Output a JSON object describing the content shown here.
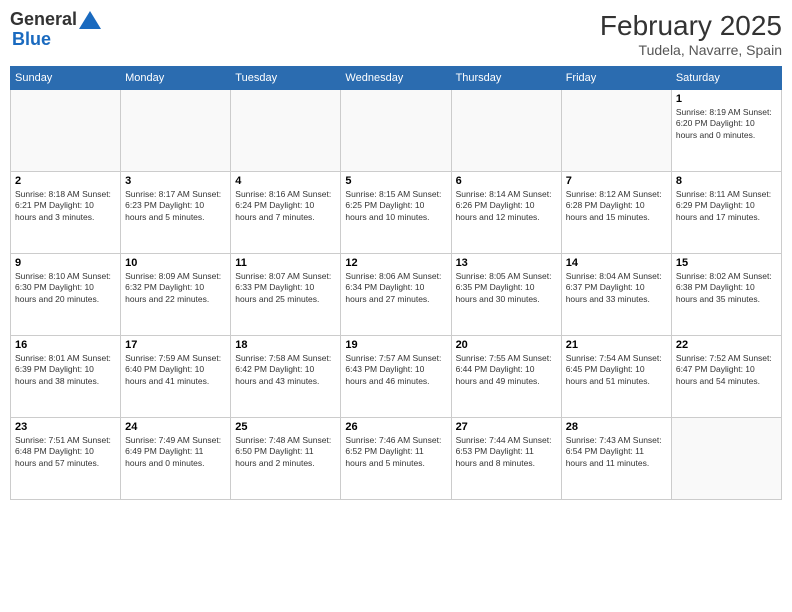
{
  "header": {
    "logo_general": "General",
    "logo_blue": "Blue",
    "month_title": "February 2025",
    "location": "Tudela, Navarre, Spain"
  },
  "days_of_week": [
    "Sunday",
    "Monday",
    "Tuesday",
    "Wednesday",
    "Thursday",
    "Friday",
    "Saturday"
  ],
  "weeks": [
    [
      {
        "day": "",
        "info": ""
      },
      {
        "day": "",
        "info": ""
      },
      {
        "day": "",
        "info": ""
      },
      {
        "day": "",
        "info": ""
      },
      {
        "day": "",
        "info": ""
      },
      {
        "day": "",
        "info": ""
      },
      {
        "day": "1",
        "info": "Sunrise: 8:19 AM\nSunset: 6:20 PM\nDaylight: 10 hours\nand 0 minutes."
      }
    ],
    [
      {
        "day": "2",
        "info": "Sunrise: 8:18 AM\nSunset: 6:21 PM\nDaylight: 10 hours\nand 3 minutes."
      },
      {
        "day": "3",
        "info": "Sunrise: 8:17 AM\nSunset: 6:23 PM\nDaylight: 10 hours\nand 5 minutes."
      },
      {
        "day": "4",
        "info": "Sunrise: 8:16 AM\nSunset: 6:24 PM\nDaylight: 10 hours\nand 7 minutes."
      },
      {
        "day": "5",
        "info": "Sunrise: 8:15 AM\nSunset: 6:25 PM\nDaylight: 10 hours\nand 10 minutes."
      },
      {
        "day": "6",
        "info": "Sunrise: 8:14 AM\nSunset: 6:26 PM\nDaylight: 10 hours\nand 12 minutes."
      },
      {
        "day": "7",
        "info": "Sunrise: 8:12 AM\nSunset: 6:28 PM\nDaylight: 10 hours\nand 15 minutes."
      },
      {
        "day": "8",
        "info": "Sunrise: 8:11 AM\nSunset: 6:29 PM\nDaylight: 10 hours\nand 17 minutes."
      }
    ],
    [
      {
        "day": "9",
        "info": "Sunrise: 8:10 AM\nSunset: 6:30 PM\nDaylight: 10 hours\nand 20 minutes."
      },
      {
        "day": "10",
        "info": "Sunrise: 8:09 AM\nSunset: 6:32 PM\nDaylight: 10 hours\nand 22 minutes."
      },
      {
        "day": "11",
        "info": "Sunrise: 8:07 AM\nSunset: 6:33 PM\nDaylight: 10 hours\nand 25 minutes."
      },
      {
        "day": "12",
        "info": "Sunrise: 8:06 AM\nSunset: 6:34 PM\nDaylight: 10 hours\nand 27 minutes."
      },
      {
        "day": "13",
        "info": "Sunrise: 8:05 AM\nSunset: 6:35 PM\nDaylight: 10 hours\nand 30 minutes."
      },
      {
        "day": "14",
        "info": "Sunrise: 8:04 AM\nSunset: 6:37 PM\nDaylight: 10 hours\nand 33 minutes."
      },
      {
        "day": "15",
        "info": "Sunrise: 8:02 AM\nSunset: 6:38 PM\nDaylight: 10 hours\nand 35 minutes."
      }
    ],
    [
      {
        "day": "16",
        "info": "Sunrise: 8:01 AM\nSunset: 6:39 PM\nDaylight: 10 hours\nand 38 minutes."
      },
      {
        "day": "17",
        "info": "Sunrise: 7:59 AM\nSunset: 6:40 PM\nDaylight: 10 hours\nand 41 minutes."
      },
      {
        "day": "18",
        "info": "Sunrise: 7:58 AM\nSunset: 6:42 PM\nDaylight: 10 hours\nand 43 minutes."
      },
      {
        "day": "19",
        "info": "Sunrise: 7:57 AM\nSunset: 6:43 PM\nDaylight: 10 hours\nand 46 minutes."
      },
      {
        "day": "20",
        "info": "Sunrise: 7:55 AM\nSunset: 6:44 PM\nDaylight: 10 hours\nand 49 minutes."
      },
      {
        "day": "21",
        "info": "Sunrise: 7:54 AM\nSunset: 6:45 PM\nDaylight: 10 hours\nand 51 minutes."
      },
      {
        "day": "22",
        "info": "Sunrise: 7:52 AM\nSunset: 6:47 PM\nDaylight: 10 hours\nand 54 minutes."
      }
    ],
    [
      {
        "day": "23",
        "info": "Sunrise: 7:51 AM\nSunset: 6:48 PM\nDaylight: 10 hours\nand 57 minutes."
      },
      {
        "day": "24",
        "info": "Sunrise: 7:49 AM\nSunset: 6:49 PM\nDaylight: 11 hours\nand 0 minutes."
      },
      {
        "day": "25",
        "info": "Sunrise: 7:48 AM\nSunset: 6:50 PM\nDaylight: 11 hours\nand 2 minutes."
      },
      {
        "day": "26",
        "info": "Sunrise: 7:46 AM\nSunset: 6:52 PM\nDaylight: 11 hours\nand 5 minutes."
      },
      {
        "day": "27",
        "info": "Sunrise: 7:44 AM\nSunset: 6:53 PM\nDaylight: 11 hours\nand 8 minutes."
      },
      {
        "day": "28",
        "info": "Sunrise: 7:43 AM\nSunset: 6:54 PM\nDaylight: 11 hours\nand 11 minutes."
      },
      {
        "day": "",
        "info": ""
      }
    ]
  ]
}
